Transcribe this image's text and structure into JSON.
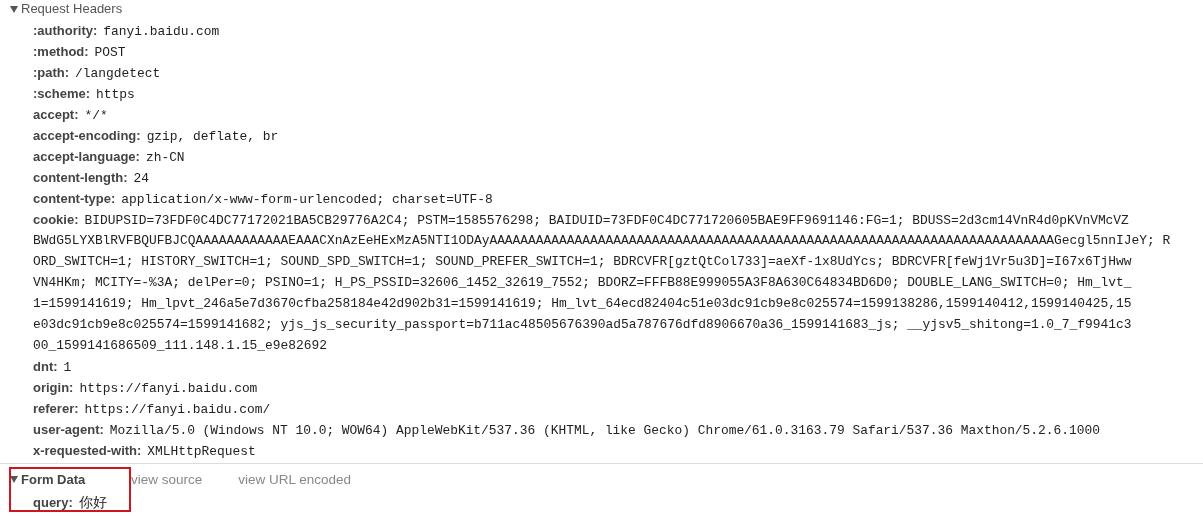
{
  "request_headers": {
    "title": "Request Headers",
    "expanded": true,
    "headers": [
      {
        "name": ":authority:",
        "value": "fanyi.baidu.com"
      },
      {
        "name": ":method:",
        "value": "POST"
      },
      {
        "name": ":path:",
        "value": "/langdetect"
      },
      {
        "name": ":scheme:",
        "value": "https"
      },
      {
        "name": "accept:",
        "value": "*/*"
      },
      {
        "name": "accept-encoding:",
        "value": "gzip, deflate, br"
      },
      {
        "name": "accept-language:",
        "value": "zh-CN"
      },
      {
        "name": "content-length:",
        "value": "24"
      },
      {
        "name": "content-type:",
        "value": "application/x-www-form-urlencoded; charset=UTF-8"
      },
      {
        "name": "cookie:",
        "lines": [
          "BIDUPSID=73FDF0C4DC77172021BA5CB29776A2C4; PSTM=1585576298; BAIDUID=73FDF0C4DC771720605BAE9FF9691146:FG=1; BDUSS=2d3cm14VnR4d0pKVnVMcVZ",
          "BWdG5LYXBlRVFBQUFBJCQAAAAAAAAAAAAEAAACXnAzEeHExMzA5NTI1ODAyAAAAAAAAAAAAAAAAAAAAAAAAAAAAAAAAAAAAAAAAAAAAAAAAAAAAAAAAAAAAAAAAAAAAAAAAAGecgl5nnIJeY; R",
          "ORD_SWITCH=1; HISTORY_SWITCH=1; SOUND_SPD_SWITCH=1; SOUND_PREFER_SWITCH=1; BDRCVFR[gztQtCol733]=aeXf-1x8UdYcs; BDRCVFR[feWj1Vr5u3D]=I67x6TjHww",
          "VN4HKm; MCITY=-%3A; delPer=0; PSINO=1; H_PS_PSSID=32606_1452_32619_7552; BDORZ=FFFB88E999055A3F8A630C64834BD6D0; DOUBLE_LANG_SWITCH=0; Hm_lvt_",
          "1=1599141619; Hm_lpvt_246a5e7d3670cfba258184e42d902b31=1599141619; Hm_lvt_64ecd82404c51e03dc91cb9e8c025574=1599138286,1599140412,1599140425,15",
          "e03dc91cb9e8c025574=1599141682; yjs_js_security_passport=b711ac48505676390ad5a787676dfd8906670a36_1599141683_js; __yjsv5_shitong=1.0_7_f9941c3",
          "00_1599141686509_111.148.1.15_e9e82692"
        ]
      },
      {
        "name": "dnt:",
        "value": "1"
      },
      {
        "name": "origin:",
        "value": "https://fanyi.baidu.com"
      },
      {
        "name": "referer:",
        "value": "https://fanyi.baidu.com/"
      },
      {
        "name": "user-agent:",
        "value": "Mozilla/5.0 (Windows NT 10.0; WOW64) AppleWebKit/537.36 (KHTML, like Gecko) Chrome/61.0.3163.79 Safari/537.36 Maxthon/5.2.6.1000"
      },
      {
        "name": "x-requested-with:",
        "value": "XMLHttpRequest"
      }
    ]
  },
  "form_data": {
    "title": "Form Data",
    "expanded": true,
    "links": [
      "view source",
      "view URL encoded"
    ],
    "fields": [
      {
        "name": "query:",
        "value": "你好"
      }
    ]
  }
}
